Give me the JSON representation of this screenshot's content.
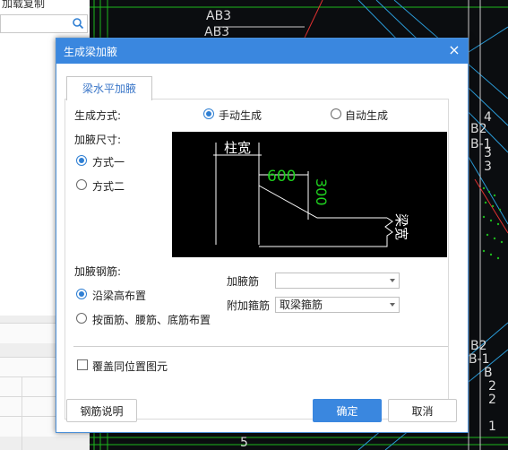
{
  "background_app": {
    "top_partial_text": "加载复制",
    "cad_texts": [
      "AB3",
      "AB3",
      "B2",
      "B-1",
      "B",
      "B2",
      "B-1",
      "5",
      "4",
      "3",
      "3",
      "2",
      "2",
      "1"
    ]
  },
  "dialog": {
    "title": "生成梁加腋",
    "close_symbol": "×",
    "tab_label": "梁水平加腋",
    "generation_mode_label": "生成方式:",
    "mode_options": [
      "手动生成",
      "自动生成"
    ],
    "mode_selected": "手动生成",
    "haunch_size_label": "加腋尺寸:",
    "size_options": [
      "方式一",
      "方式二"
    ],
    "size_selected": "方式一",
    "rebar_label": "加腋钢筋:",
    "rebar_options": [
      "沿梁高布置",
      "按面筋、腰筋、底筋布置"
    ],
    "rebar_selected": "沿梁高布置",
    "haunch_bar_label": "加腋筋",
    "haunch_bar_value": "",
    "stirrup_label": "附加箍筋",
    "stirrup_value": "取梁箍筋",
    "overlay_checkbox_label": "覆盖同位置图元",
    "overlay_checked": false,
    "rebar_note_button": "钢筋说明",
    "ok_button": "确定",
    "cancel_button": "取消"
  },
  "preview": {
    "column_width_label": "柱宽",
    "length_value": "600",
    "height_value": "300",
    "beam_width_label": "梁宽",
    "line_color": "#ffffff",
    "value_color": "#1fd01f"
  },
  "colors": {
    "titlebar": "#3a87df",
    "accent": "#2f7fd3",
    "cad_background": "#0b0d10"
  }
}
